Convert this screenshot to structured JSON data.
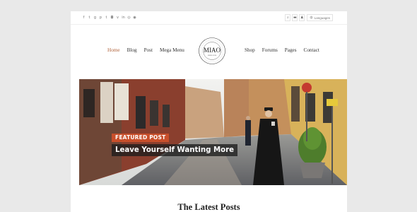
{
  "topbar": {
    "social_icons": [
      "facebook-icon",
      "twitter-icon",
      "google-plus-icon",
      "pinterest-icon",
      "tumblr-icon",
      "instagram-icon",
      "vimeo-icon",
      "linkedin-icon",
      "dribbble-icon",
      "rss-icon"
    ],
    "social_glyphs": [
      "f",
      "t",
      "g",
      "p",
      "t",
      "◘",
      "v",
      "in",
      "◎",
      "◉"
    ],
    "search_glyph": "⌕",
    "cart_glyph": "▬",
    "user_glyph": "♟",
    "language_label": "Languages",
    "globe_glyph": "◍"
  },
  "nav": {
    "left": [
      "Home",
      "Blog",
      "Post",
      "Mega Menu"
    ],
    "right": [
      "Shop",
      "Forums",
      "Pages",
      "Contact"
    ],
    "active": "Home",
    "active_color": "#b2653d"
  },
  "logo": {
    "title": "MIAO",
    "subtitle": "SINCE 2016"
  },
  "hero": {
    "badge": "FEATURED POST",
    "headline": "Leave Yourself Wanting More",
    "badge_color": "#c84f2b"
  },
  "section": {
    "title": "The Latest Posts"
  }
}
